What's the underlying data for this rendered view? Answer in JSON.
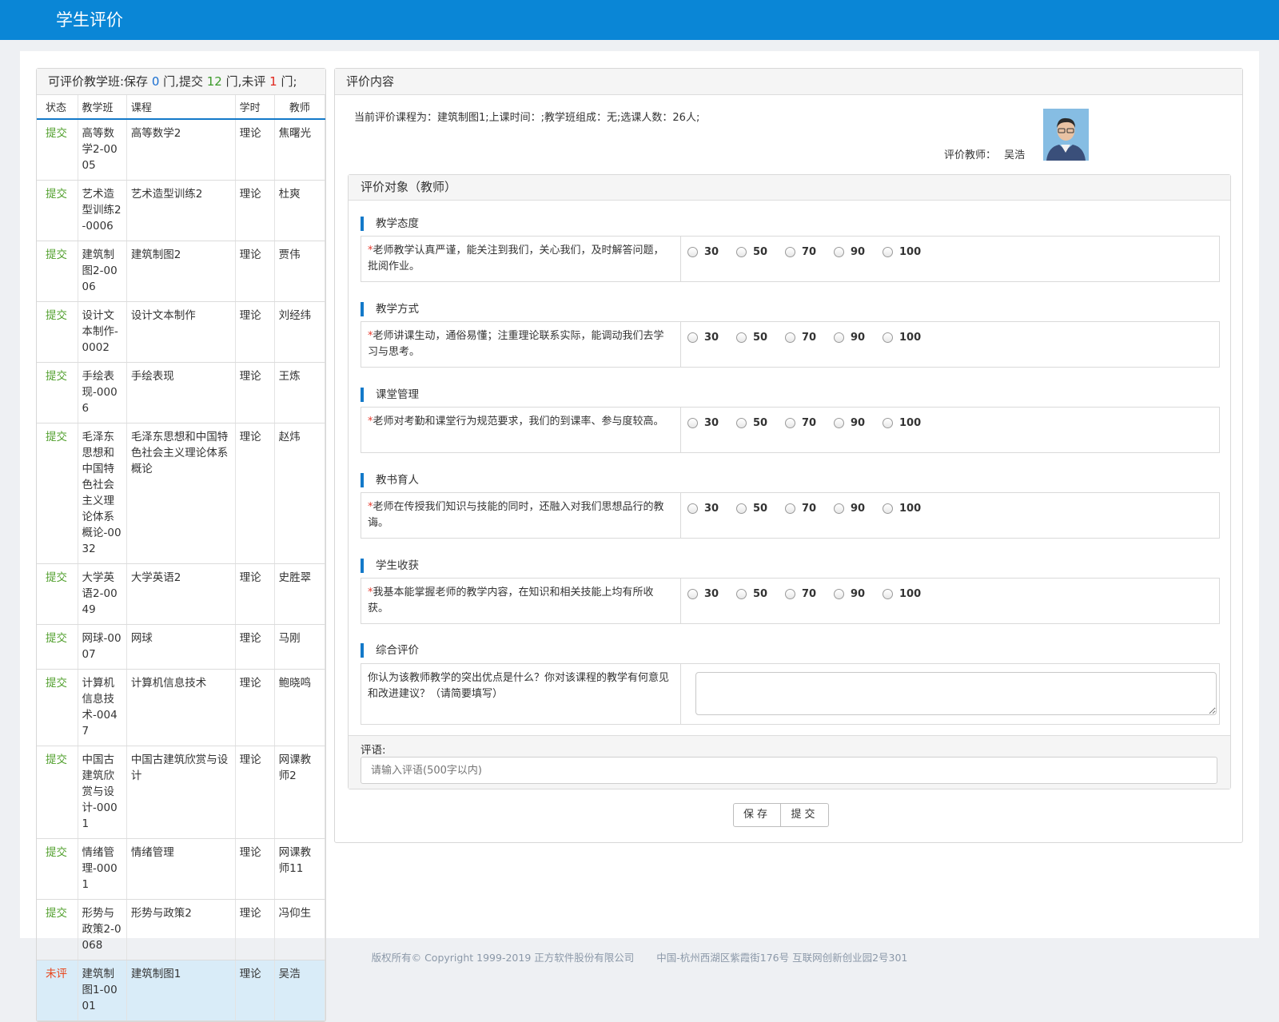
{
  "header": {
    "title": "学生评价"
  },
  "left": {
    "title_prefix": "可评价教学班:保存",
    "saved": "0",
    "mid1": "门,提交",
    "submitted": "12",
    "mid2": "门,未评",
    "unrated": "1",
    "suffix": "门;",
    "columns": [
      "状态",
      "教学班",
      "课程",
      "学时",
      "教师"
    ],
    "rows": [
      {
        "status": "提交",
        "cls": "高等数学2-0005",
        "course": "高等数学2",
        "hours": "理论",
        "teacher": "焦曙光"
      },
      {
        "status": "提交",
        "cls": "艺术造型训练2-0006",
        "course": "艺术造型训练2",
        "hours": "理论",
        "teacher": "杜爽"
      },
      {
        "status": "提交",
        "cls": "建筑制图2-0006",
        "course": "建筑制图2",
        "hours": "理论",
        "teacher": "贾伟"
      },
      {
        "status": "提交",
        "cls": "设计文本制作-0002",
        "course": "设计文本制作",
        "hours": "理论",
        "teacher": "刘经纬"
      },
      {
        "status": "提交",
        "cls": "手绘表现-0006",
        "course": "手绘表现",
        "hours": "理论",
        "teacher": "王炼"
      },
      {
        "status": "提交",
        "cls": "毛泽东思想和中国特色社会主义理论体系概论-0032",
        "course": "毛泽东思想和中国特色社会主义理论体系概论",
        "hours": "理论",
        "teacher": "赵炜"
      },
      {
        "status": "提交",
        "cls": "大学英语2-0049",
        "course": "大学英语2",
        "hours": "理论",
        "teacher": "史胜翠"
      },
      {
        "status": "提交",
        "cls": "网球-0007",
        "course": "网球",
        "hours": "理论",
        "teacher": "马刚"
      },
      {
        "status": "提交",
        "cls": "计算机信息技术-0047",
        "course": "计算机信息技术",
        "hours": "理论",
        "teacher": "鲍晓鸣"
      },
      {
        "status": "提交",
        "cls": "中国古建筑欣赏与设计-0001",
        "course": "中国古建筑欣赏与设计",
        "hours": "理论",
        "teacher": "网课教师2"
      },
      {
        "status": "提交",
        "cls": "情绪管理-0001",
        "course": "情绪管理",
        "hours": "理论",
        "teacher": "网课教师11"
      },
      {
        "status": "提交",
        "cls": "形势与政策2-0068",
        "course": "形势与政策2",
        "hours": "理论",
        "teacher": "冯仰生"
      },
      {
        "status": "未评",
        "cls": "建筑制图1-0001",
        "course": "建筑制图1",
        "hours": "理论",
        "teacher": "吴浩"
      }
    ]
  },
  "right": {
    "title": "评价内容",
    "info": "当前评价课程为：建筑制图1;上课时间：;教学班组成：无;选课人数：26人;",
    "teacher_label": "评价教师：",
    "teacher_name": "吴浩",
    "inner_title": "评价对象（教师）",
    "options": [
      "30",
      "50",
      "70",
      "90",
      "100"
    ],
    "sections": [
      {
        "title": "教学态度",
        "question": "老师教学认真严谨，能关注到我们，关心我们，及时解答问题，批阅作业。"
      },
      {
        "title": "教学方式",
        "question": "老师讲课生动，通俗易懂；注重理论联系实际，能调动我们去学习与思考。"
      },
      {
        "title": "课堂管理",
        "question": "老师对考勤和课堂行为规范要求，我们的到课率、参与度较高。"
      },
      {
        "title": "教书育人",
        "question": "老师在传授我们知识与技能的同时，还融入对我们思想品行的教诲。"
      },
      {
        "title": "学生收获",
        "question": "我基本能掌握老师的教学内容，在知识和相关技能上均有所收获。"
      }
    ],
    "summary": {
      "title": "综合评价",
      "question": "你认为该教师教学的突出优点是什么？你对该课程的教学有何意见和改进建议？（请简要填写）"
    },
    "comment_label": "评语:",
    "comment_placeholder": "请输入评语(500字以内)",
    "save_label": "保存",
    "submit_label": "提交"
  },
  "footer": {
    "copyright": "版权所有© Copyright 1999-2019 正方软件股份有限公司",
    "address": "中国-杭州西湖区紫霞街176号 互联网创新创业园2号301"
  }
}
